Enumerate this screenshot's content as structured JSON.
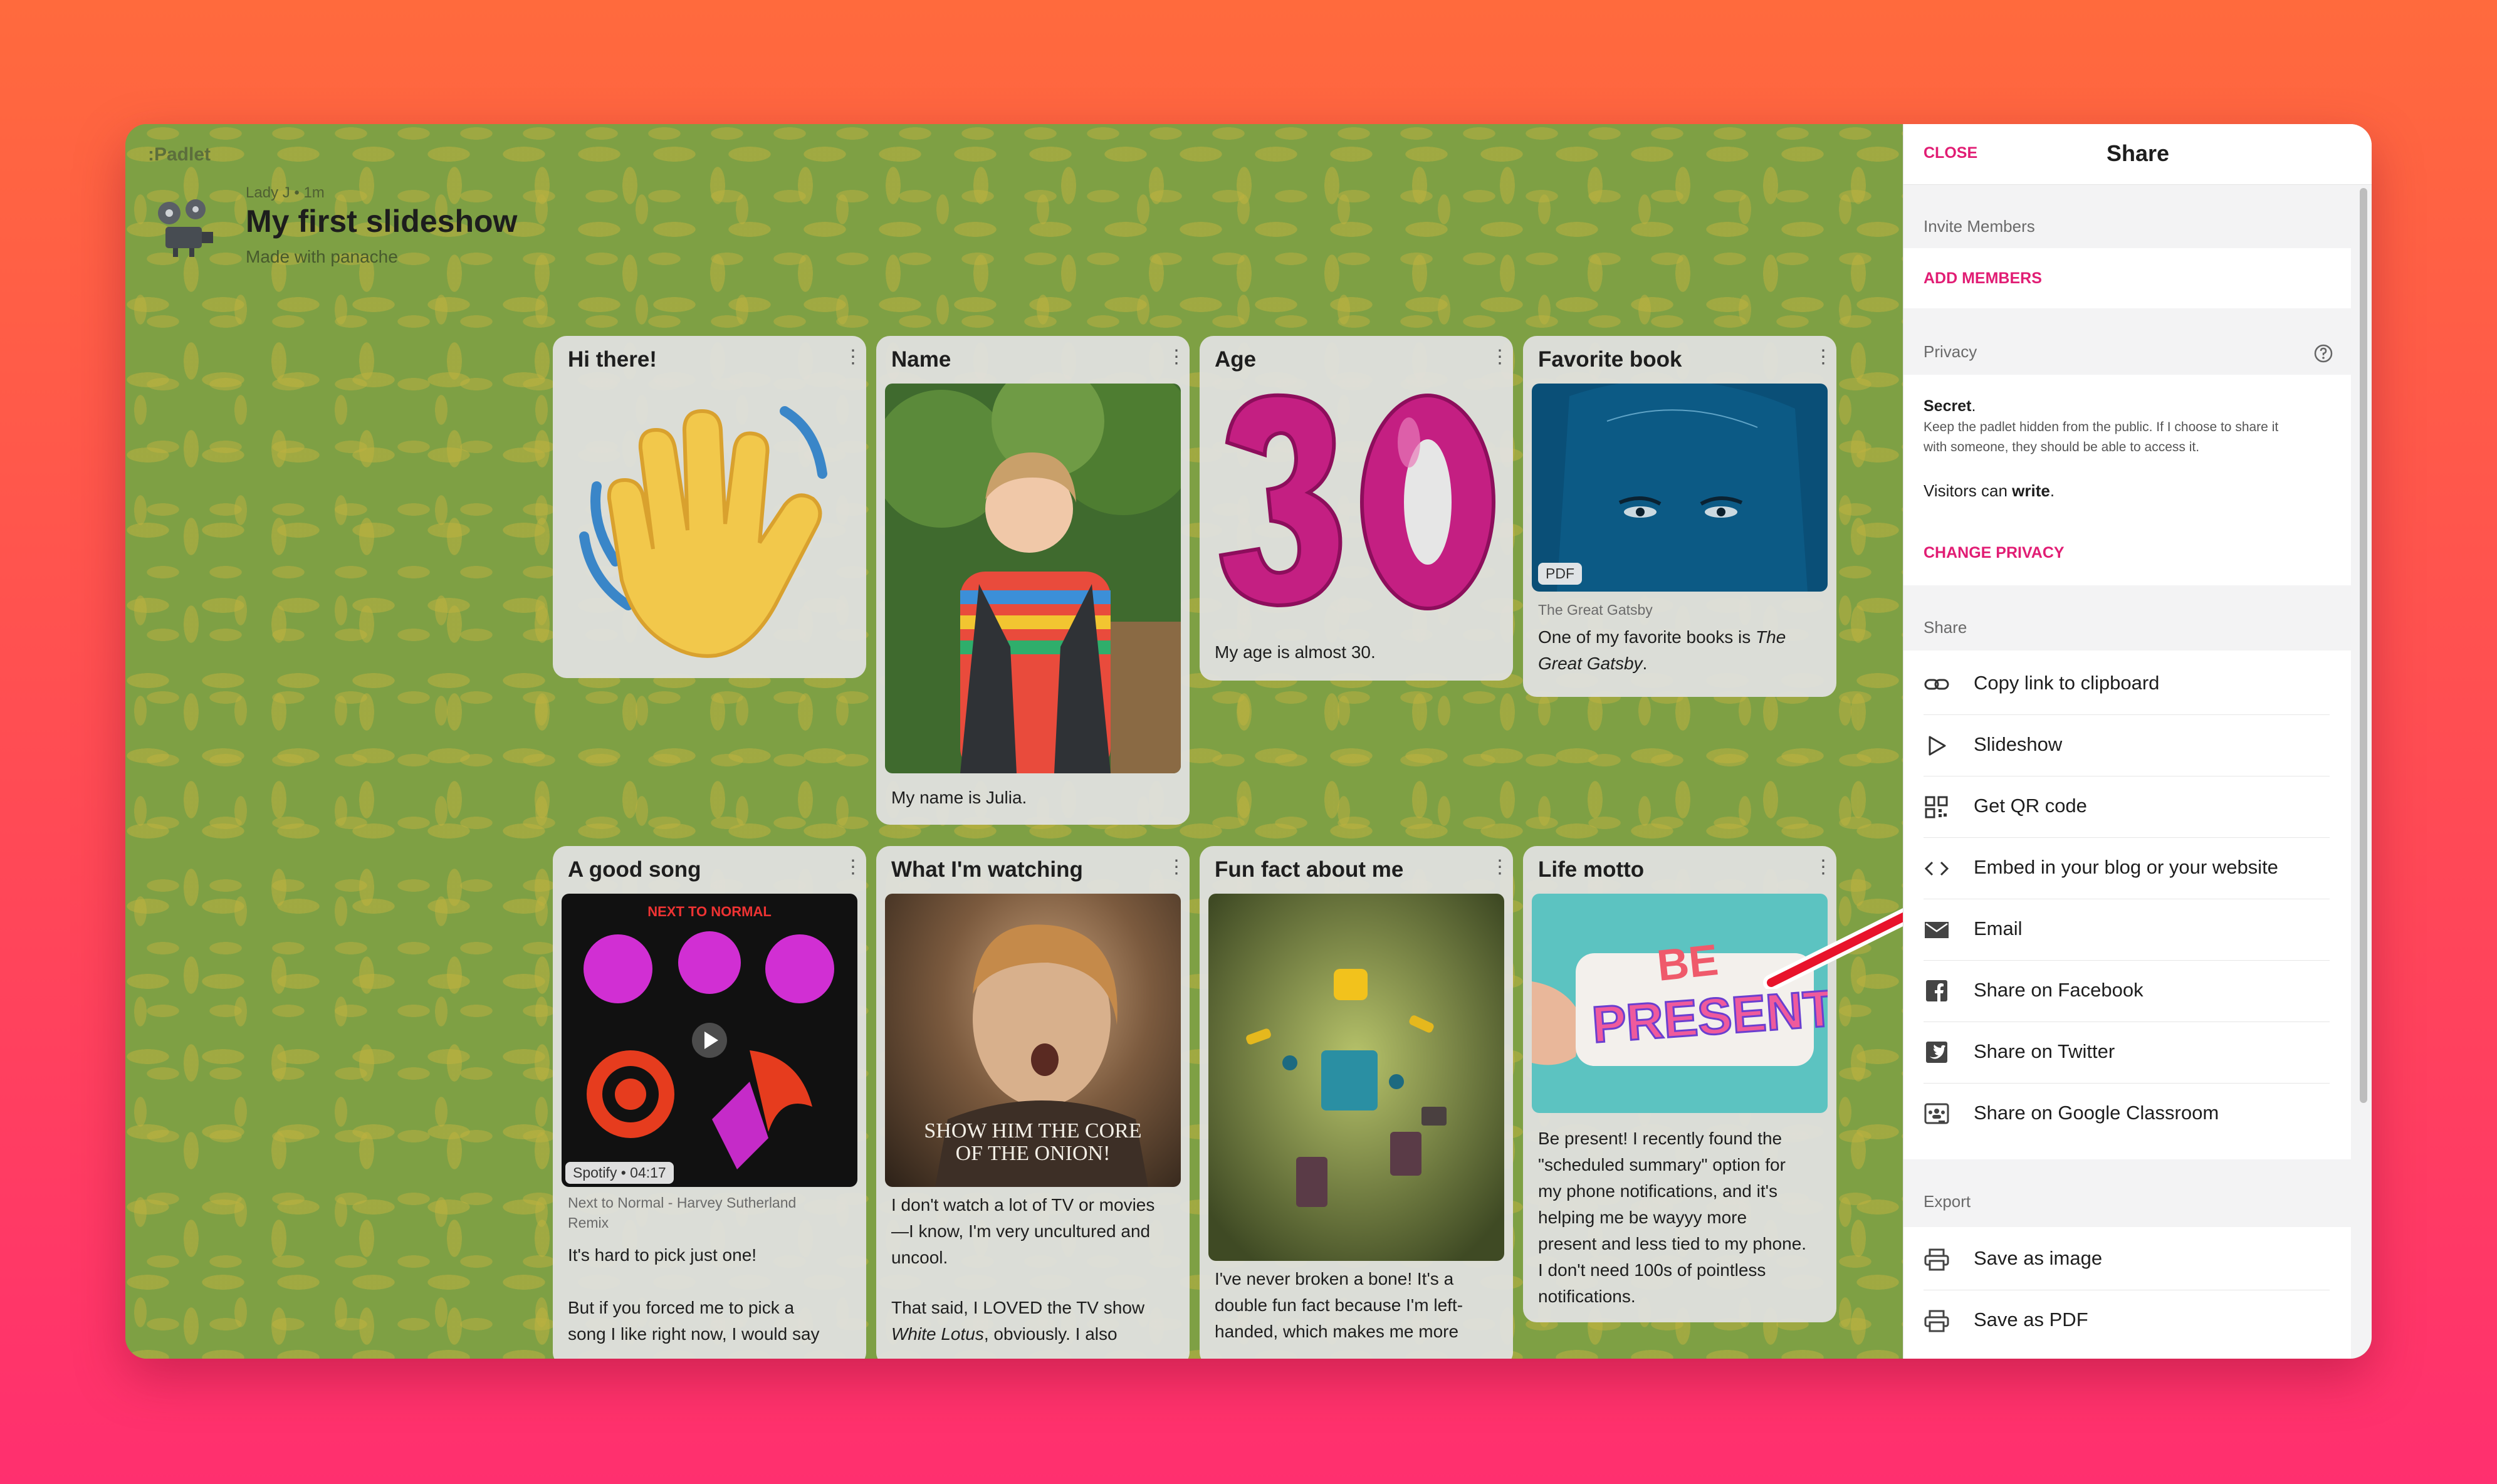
{
  "board": {
    "brand": ":Padlet",
    "author_line": "Lady J • 1m",
    "title": "My first slideshow",
    "subtitle": "Made with panache"
  },
  "cards": {
    "hi": {
      "title": "Hi there!"
    },
    "name": {
      "title": "Name",
      "body": "My name is Julia."
    },
    "age": {
      "title": "Age",
      "body": "My age is almost 30."
    },
    "book": {
      "title": "Favorite book",
      "badge": "PDF",
      "source": "The Great Gatsby",
      "body1": "One of my favorite books is ",
      "body_em": "The Great Gatsby",
      "body2": "."
    },
    "song": {
      "title": "A good song",
      "badge": "Spotify • 04:17",
      "source1": "Next to Normal - Harvey Sutherland",
      "source2": "Remix",
      "body1": "It's hard to pick just one!",
      "body2": "But if you forced me to pick a",
      "body3": "song I like right now, I would say"
    },
    "watching": {
      "title": "What I'm watching",
      "caption1": "SHOW HIM THE CORE",
      "caption2": "OF THE ONION!",
      "l1": "I don't watch a lot of TV or movies",
      "l2": "—I know, I'm very uncultured and",
      "l3": "uncool.",
      "l4": "That said, I LOVED the TV show",
      "l5_em": "White Lotus",
      "l5_rest": ", obviously. I also"
    },
    "funfact": {
      "title": "Fun fact about me",
      "l1": "I've never broken a bone! It's a",
      "l2": "double fun fact because I'm left-",
      "l3": "handed, which makes me more"
    },
    "motto": {
      "title": "Life motto",
      "sticker1": "BE",
      "sticker2": "PRESENT",
      "l1": "Be present! I recently found the",
      "l2": "\"scheduled summary\" option for",
      "l3": "my phone notifications, and it's",
      "l4": "helping me be wayyy more",
      "l5": "present and less tied to my phone.",
      "l6": "I don't need 100s of pointless",
      "l7": "notifications."
    }
  },
  "panel": {
    "close": "CLOSE",
    "title": "Share",
    "invite_label": "Invite Members",
    "add_members": "ADD MEMBERS",
    "privacy_label": "Privacy",
    "privacy_name": "Secret",
    "privacy_desc1": "Keep the padlet hidden from the public. If I choose to share it",
    "privacy_desc2": "with someone, they should be able to access it.",
    "visitors_prefix": "Visitors can ",
    "visitors_perm": "write",
    "change_privacy": "CHANGE PRIVACY",
    "share_label": "Share",
    "share_items": [
      {
        "label": "Copy link to clipboard",
        "icon": "link-icon"
      },
      {
        "label": "Slideshow",
        "icon": "play-icon"
      },
      {
        "label": "Get QR code",
        "icon": "qr-code-icon"
      },
      {
        "label": "Embed in your blog or your website",
        "icon": "code-icon"
      },
      {
        "label": "Email",
        "icon": "envelope-icon"
      },
      {
        "label": "Share on Facebook",
        "icon": "facebook-icon"
      },
      {
        "label": "Share on Twitter",
        "icon": "twitter-icon"
      },
      {
        "label": "Share on Google Classroom",
        "icon": "google-classroom-icon"
      }
    ],
    "export_label": "Export",
    "export_items": [
      {
        "label": "Save as image",
        "icon": "printer-icon"
      },
      {
        "label": "Save as PDF",
        "icon": "printer-icon"
      }
    ]
  },
  "colors": {
    "accent": "#e11d74",
    "arrow": "#e8132b"
  }
}
